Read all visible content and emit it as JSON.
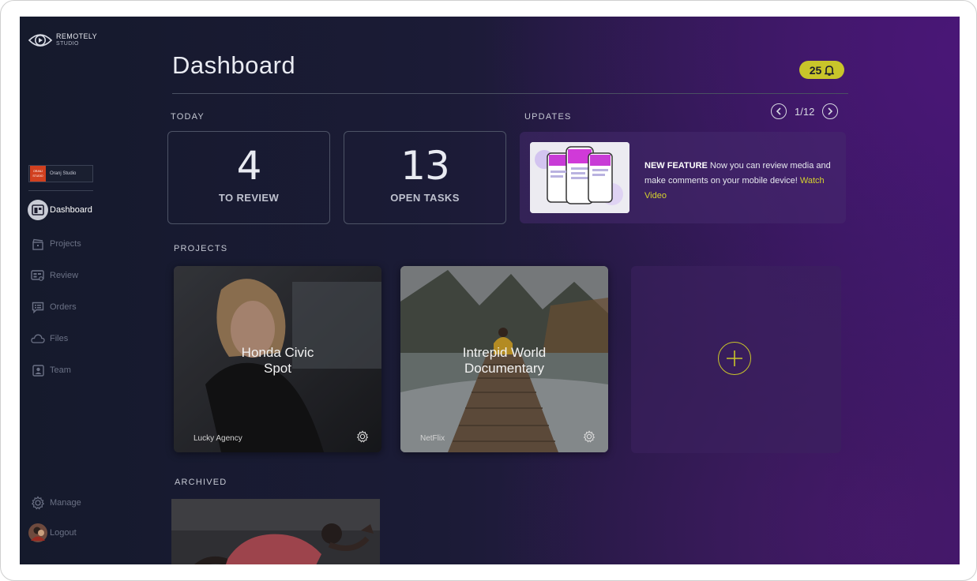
{
  "app": {
    "logo_line1": "REMOTELY",
    "logo_line2": "STUDIO"
  },
  "sidebar": {
    "studio": {
      "logo_text": "ORANJ STUDIO",
      "name": "Oranj Studio"
    },
    "items": [
      {
        "label": "Dashboard",
        "icon": "dashboard-icon",
        "active": true
      },
      {
        "label": "Projects",
        "icon": "clapperboard-icon"
      },
      {
        "label": "Review",
        "icon": "review-icon"
      },
      {
        "label": "Orders",
        "icon": "orders-icon"
      },
      {
        "label": "Files",
        "icon": "cloud-icon"
      },
      {
        "label": "Team",
        "icon": "team-icon"
      }
    ],
    "manage_label": "Manage",
    "logout_label": "Logout"
  },
  "header": {
    "title": "Dashboard",
    "notification_count": "25"
  },
  "today": {
    "label": "TODAY",
    "cards": [
      {
        "value": "4",
        "caption": "TO REVIEW"
      },
      {
        "value": "13",
        "caption": "OPEN TASKS"
      }
    ]
  },
  "updates": {
    "label": "UPDATES",
    "pager": "1/12",
    "headline": "NEW FEATURE",
    "body": " Now you can review media and make comments on your mobile device! ",
    "link": "Watch Video"
  },
  "projects": {
    "label": "PROJECTS",
    "items": [
      {
        "title_line1": "Honda Civic",
        "title_line2": "Spot",
        "client": "Lucky Agency"
      },
      {
        "title_line1": "Intrepid World",
        "title_line2": "Documentary",
        "client": "NetFlix"
      }
    ]
  },
  "archived": {
    "label": "ARCHIVED"
  },
  "colors": {
    "accent": "#c9c52a",
    "link": "#d6d32d",
    "bg_dark": "#151a2c",
    "bg_purple": "#4a1777"
  }
}
